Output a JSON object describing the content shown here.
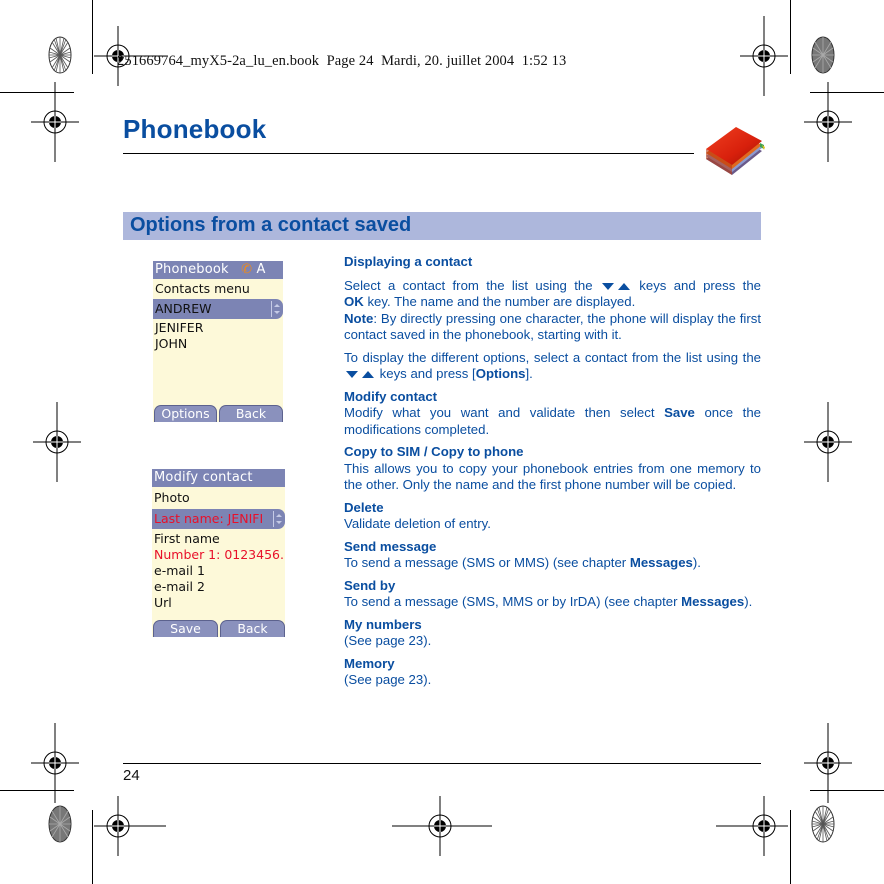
{
  "print_header": "251669764_myX5-2a_lu_en.book  Page 24  Mardi, 20. juillet 2004  1:52 13",
  "page": {
    "title": "Phonebook",
    "chapter_icon": "phonebook-book-icon",
    "section_title": "Options from a contact saved",
    "page_number": "24"
  },
  "screens": {
    "contacts": {
      "title": "Phonebook",
      "title_suffix": "A",
      "header_row": "Contacts menu",
      "selected": "ANDREW",
      "items": [
        "JENIFER",
        "JOHN"
      ],
      "softkeys": [
        "Options",
        "Back"
      ]
    },
    "modify": {
      "title": "Modify contact",
      "rows": [
        {
          "label": "Photo",
          "color": "#111111"
        },
        {
          "label": "Last name: JENIFI",
          "color": "#e8102a",
          "selected": true
        },
        {
          "label": "First name",
          "color": "#111111"
        },
        {
          "label": "Number 1: 0123456.",
          "color": "#e8102a"
        },
        {
          "label": "e-mail 1",
          "color": "#111111"
        },
        {
          "label": "e-mail 2",
          "color": "#111111"
        },
        {
          "label": "Url",
          "color": "#111111"
        }
      ],
      "softkeys": [
        "Save",
        "Back"
      ]
    }
  },
  "sections": {
    "displaying": {
      "heading": "Displaying a contact",
      "p1_a": "Select a contact from the list using the",
      "p1_b": "keys and press the",
      "p1_ok": "OK",
      "p1_c": " key. The name and the number are displayed.",
      "note_label": "Note",
      "note_text": ": By directly pressing one character, the phone will display the first contact saved in the phonebook, starting with it.",
      "p2_a": "To display the different options, select a contact from the list using the",
      "p2_b": " keys and press [",
      "p2_options": "Options",
      "p2_c": "]."
    },
    "modify": {
      "heading": "Modify contact",
      "text_a": "Modify what you want and validate then select ",
      "text_save": "Save",
      "text_b": " once the modifications completed."
    },
    "copy": {
      "heading": "Copy to SIM / Copy to phone",
      "text": "This allows you to copy your phonebook entries from one memory to the other. Only the name and the first phone number will be copied."
    },
    "delete": {
      "heading": "Delete",
      "text": "Validate deletion of entry."
    },
    "send_message": {
      "heading": "Send message",
      "text_a": "To send a message (SMS or MMS) (see chapter ",
      "text_link": "Messages",
      "text_b": ")."
    },
    "send_by": {
      "heading": "Send by",
      "text_a": "To send a message (SMS, MMS or by IrDA) (see chapter ",
      "text_link": "Messages",
      "text_b": ")."
    },
    "my_numbers": {
      "heading": "My numbers",
      "text": "(See page 23)."
    },
    "memory": {
      "heading": "Memory",
      "text": "(See page 23)."
    }
  },
  "colors": {
    "accent_blue": "#0a4ea0",
    "section_bar": "#adb7dc",
    "screen_bg": "#fdf9d9",
    "screen_bar": "#7c84b4",
    "screen_red": "#e8102a"
  }
}
